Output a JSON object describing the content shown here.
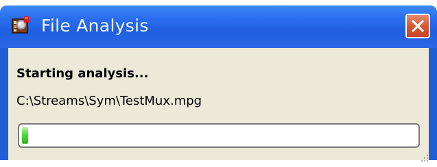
{
  "window": {
    "title": "File Analysis",
    "app_icon": "analysis-app-icon",
    "close_icon": "close-icon"
  },
  "content": {
    "status": "Starting analysis...",
    "file_path": "C:\\Streams\\Sym\\TestMux.mpg"
  },
  "progress": {
    "value_percent": 1.5
  },
  "colors": {
    "titlebar": "#2a6ff0",
    "client": "#ece9d8",
    "close_button": "#d4552f",
    "progress_fill": "#4ed83c"
  }
}
